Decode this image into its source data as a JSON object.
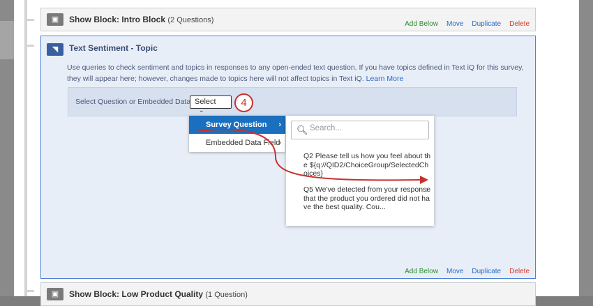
{
  "intro_block": {
    "title": "Show Block: Intro Block",
    "count": "(2 Questions)"
  },
  "main_block": {
    "title": "Text Sentiment - Topic",
    "description": "Use queries to check sentiment and topics in responses to any open-ended text question. If you have topics defined in Text iQ for this survey, they will appear here; however, changes made to topics here will not affect topics in Text iQ.",
    "learn_more": "Learn More",
    "select_label": "Select Question or Embedded Data",
    "select_value": "Select",
    "step_number": "4"
  },
  "menu": {
    "items": [
      {
        "label": "Survey Question"
      },
      {
        "label": "Embedded Data Field"
      }
    ]
  },
  "submenu": {
    "search_placeholder": "Search...",
    "questions": [
      {
        "text": "Q2 Please tell us how you feel about the ${q://QID2/ChoiceGroup/SelectedChoices}"
      },
      {
        "text": "Q5 We've detected from your response that the product you ordered did not have the best quality. Cou..."
      }
    ]
  },
  "actions": {
    "add_below": "Add Below",
    "move": "Move",
    "duplicate": "Duplicate",
    "delete": "Delete"
  },
  "bottom_block": {
    "title": "Show Block: Low Product Quality",
    "count": "(1 Question)"
  },
  "colors": {
    "accent": "#1a6fbf",
    "annotation": "#c9302c"
  }
}
